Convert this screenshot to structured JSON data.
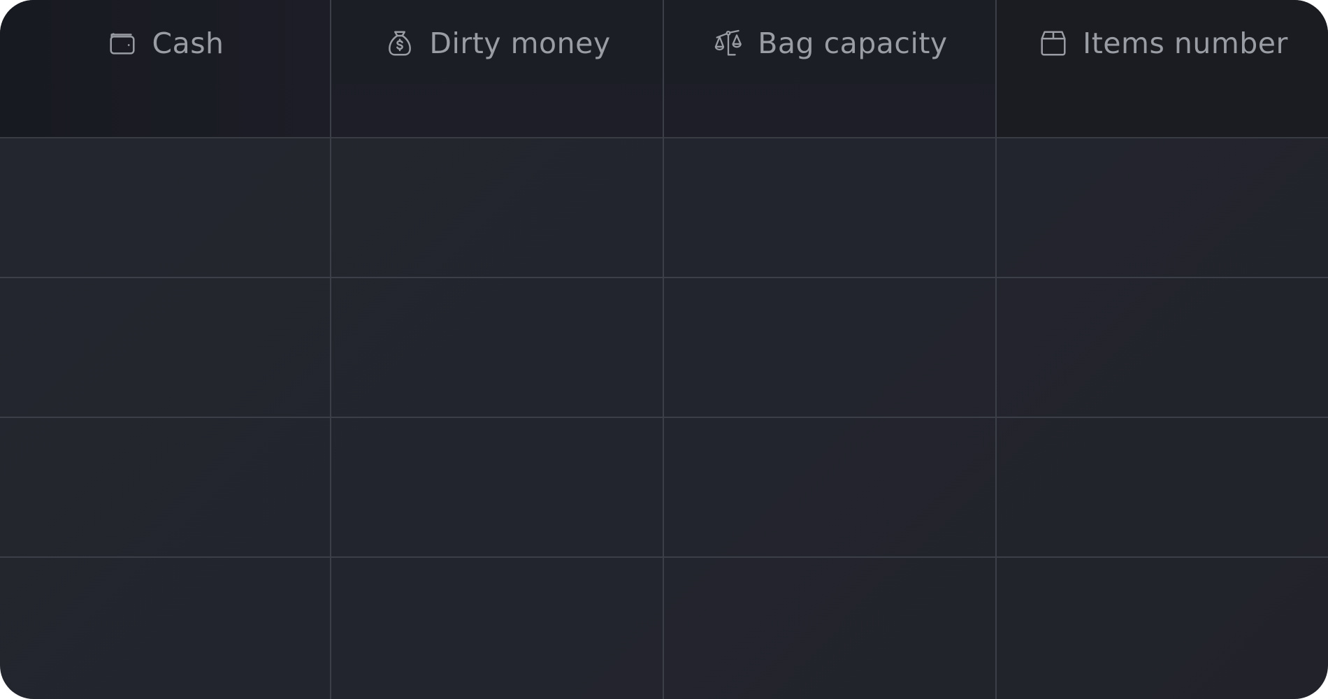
{
  "table": {
    "columns": [
      {
        "label": "Cash",
        "icon": "wallet-icon"
      },
      {
        "label": "Dirty money",
        "icon": "money-bag-icon"
      },
      {
        "label": "Bag capacity",
        "icon": "scale-icon"
      },
      {
        "label": "Items number",
        "icon": "box-icon"
      }
    ],
    "rows": [
      [
        "",
        "",
        "",
        ""
      ],
      [
        "",
        "",
        "",
        ""
      ],
      [
        "",
        "",
        "",
        ""
      ],
      [
        "",
        "",
        "",
        ""
      ]
    ]
  },
  "colors": {
    "background": "#23252e",
    "header_background": "#1c1e26",
    "grid_line": "#3d3f48",
    "text": "#9b9da5"
  }
}
